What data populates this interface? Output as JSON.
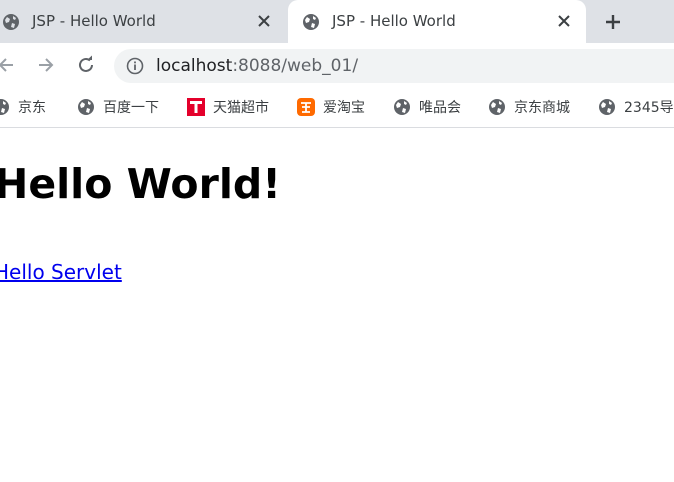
{
  "browser": {
    "tabs": [
      {
        "title": "JSP - Hello World",
        "active": false
      },
      {
        "title": "JSP - Hello World",
        "active": true
      }
    ],
    "new_tab_icon": "plus-icon",
    "address": {
      "host": "localhost",
      "rest": ":8088/web_01/"
    },
    "bookmarks": [
      {
        "label": "京东",
        "icon": "globe-icon"
      },
      {
        "label": "百度一下",
        "icon": "globe-icon"
      },
      {
        "label": "天猫超市",
        "icon": "tmall-icon"
      },
      {
        "label": "爱淘宝",
        "icon": "taobao-icon"
      },
      {
        "label": "唯品会",
        "icon": "globe-icon"
      },
      {
        "label": "京东商城",
        "icon": "globe-icon"
      },
      {
        "label": "2345导",
        "icon": "globe-icon"
      }
    ]
  },
  "page": {
    "heading": "Hello World!",
    "link": "Hello Servlet"
  },
  "colors": {
    "tab_strip": "#dee1e6",
    "omnibox": "#f1f3f4",
    "link": "#0000ee",
    "tmall": "#e4002b",
    "taobao": "#ff6a00"
  }
}
